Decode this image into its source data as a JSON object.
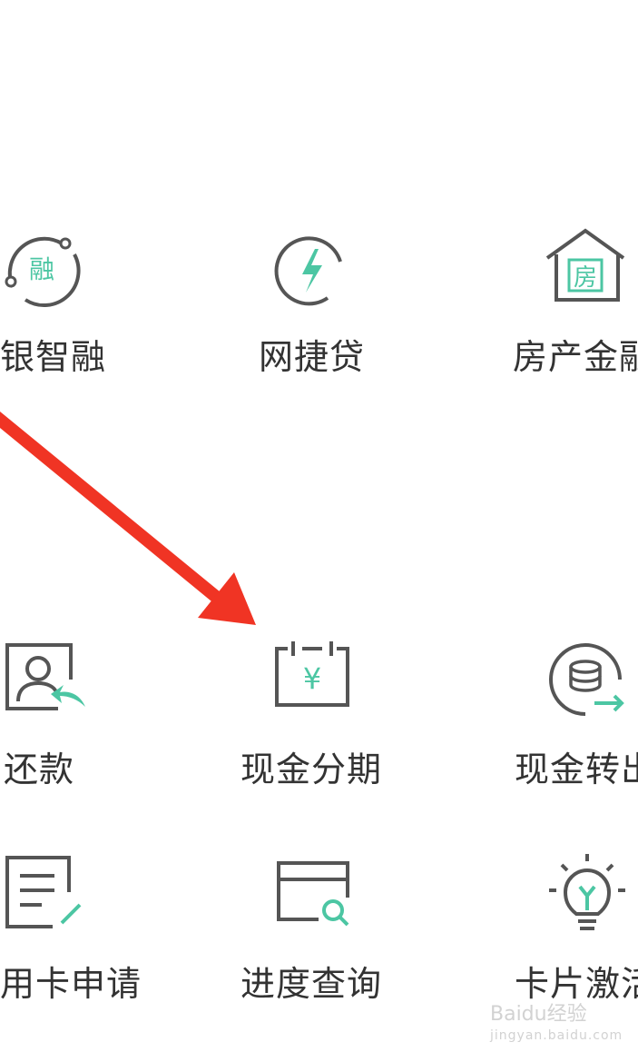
{
  "colors": {
    "icon_gray": "#555555",
    "icon_green": "#4cc6a3",
    "text": "#333333",
    "arrow": "#f03424"
  },
  "grid": {
    "row1": [
      {
        "label": "银智融",
        "icon": "rong-cycle-icon",
        "icon_text": "融"
      },
      {
        "label": "网捷贷",
        "icon": "lightning-circle-icon"
      },
      {
        "label": "房产金融",
        "icon": "house-icon",
        "icon_text": "房"
      }
    ],
    "row2": [
      {
        "label": "还款",
        "icon": "repay-user-icon"
      },
      {
        "label": "现金分期",
        "icon": "calendar-yuan-icon",
        "icon_text": "¥"
      },
      {
        "label": "现金转出",
        "icon": "coin-transfer-icon"
      }
    ],
    "row3": [
      {
        "label": "用卡申请",
        "icon": "document-edit-icon"
      },
      {
        "label": "进度查询",
        "icon": "card-search-icon"
      },
      {
        "label": "卡片激活",
        "icon": "lightbulb-icon"
      }
    ]
  },
  "watermark": {
    "brand": "Baidu经验",
    "url": "jingyan.baidu.com"
  }
}
